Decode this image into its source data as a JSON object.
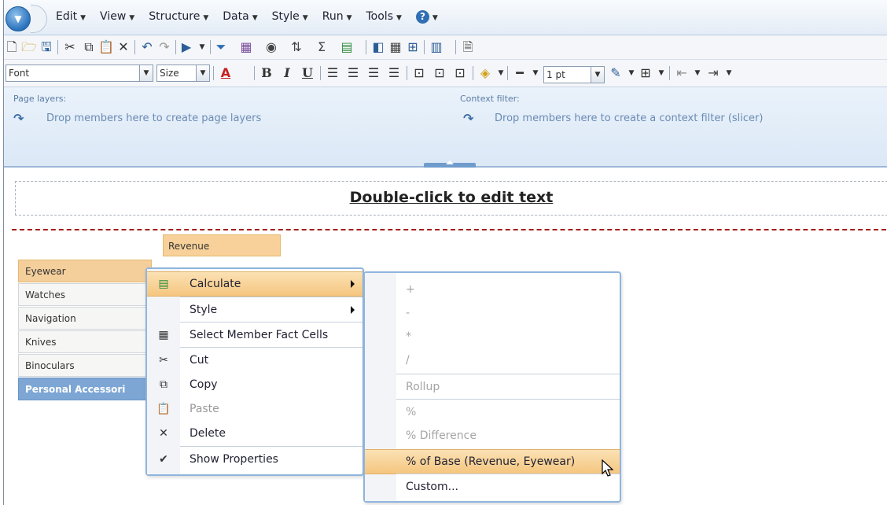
{
  "menubar": {
    "app_button_icon": "app-menu-icon",
    "items": [
      {
        "label": "Edit"
      },
      {
        "label": "View"
      },
      {
        "label": "Structure"
      },
      {
        "label": "Data"
      },
      {
        "label": "Style"
      },
      {
        "label": "Run"
      },
      {
        "label": "Tools"
      }
    ],
    "help_label": "?"
  },
  "format_toolbar": {
    "font_value": "Font",
    "size_value": "Size",
    "line_width_value": "1 pt",
    "bold": "B",
    "italic": "I",
    "underline": "U",
    "font_color": "A"
  },
  "layers": {
    "page_layers_label": "Page layers:",
    "page_layers_hint": "Drop members here to create page layers",
    "context_filter_label": "Context filter:",
    "context_filter_hint": "Drop members here to create a context filter (slicer)"
  },
  "report": {
    "title": "Double-click to edit text",
    "column_header": "Revenue",
    "rows": [
      "Eyewear",
      "Watches",
      "Navigation",
      "Knives",
      "Binoculars"
    ],
    "total_row": "Personal Accessori"
  },
  "context_menu": {
    "items": [
      {
        "label": "Calculate",
        "icon": "calculate-icon"
      },
      {
        "label": "Style"
      },
      {
        "label": "Select Member Fact Cells",
        "icon": "table-icon"
      },
      {
        "label": "Cut",
        "icon": "scissors-icon"
      },
      {
        "label": "Copy",
        "icon": "copy-icon"
      },
      {
        "label": "Paste",
        "icon": "paste-icon"
      },
      {
        "label": "Delete",
        "icon": "delete-x-icon"
      },
      {
        "label": "Show Properties",
        "icon": "checkmark-icon"
      }
    ]
  },
  "calculate_submenu": {
    "items": [
      "+",
      "-",
      "*",
      "/",
      "Rollup",
      "%",
      "% Difference",
      "% of Base (Revenue, Eyewear)",
      "Custom..."
    ]
  },
  "colors": {
    "highlight": "#f5c67f",
    "selected_row": "#f4cf9c",
    "total_row": "#7da6d4",
    "page_break": "#a61c1c"
  }
}
